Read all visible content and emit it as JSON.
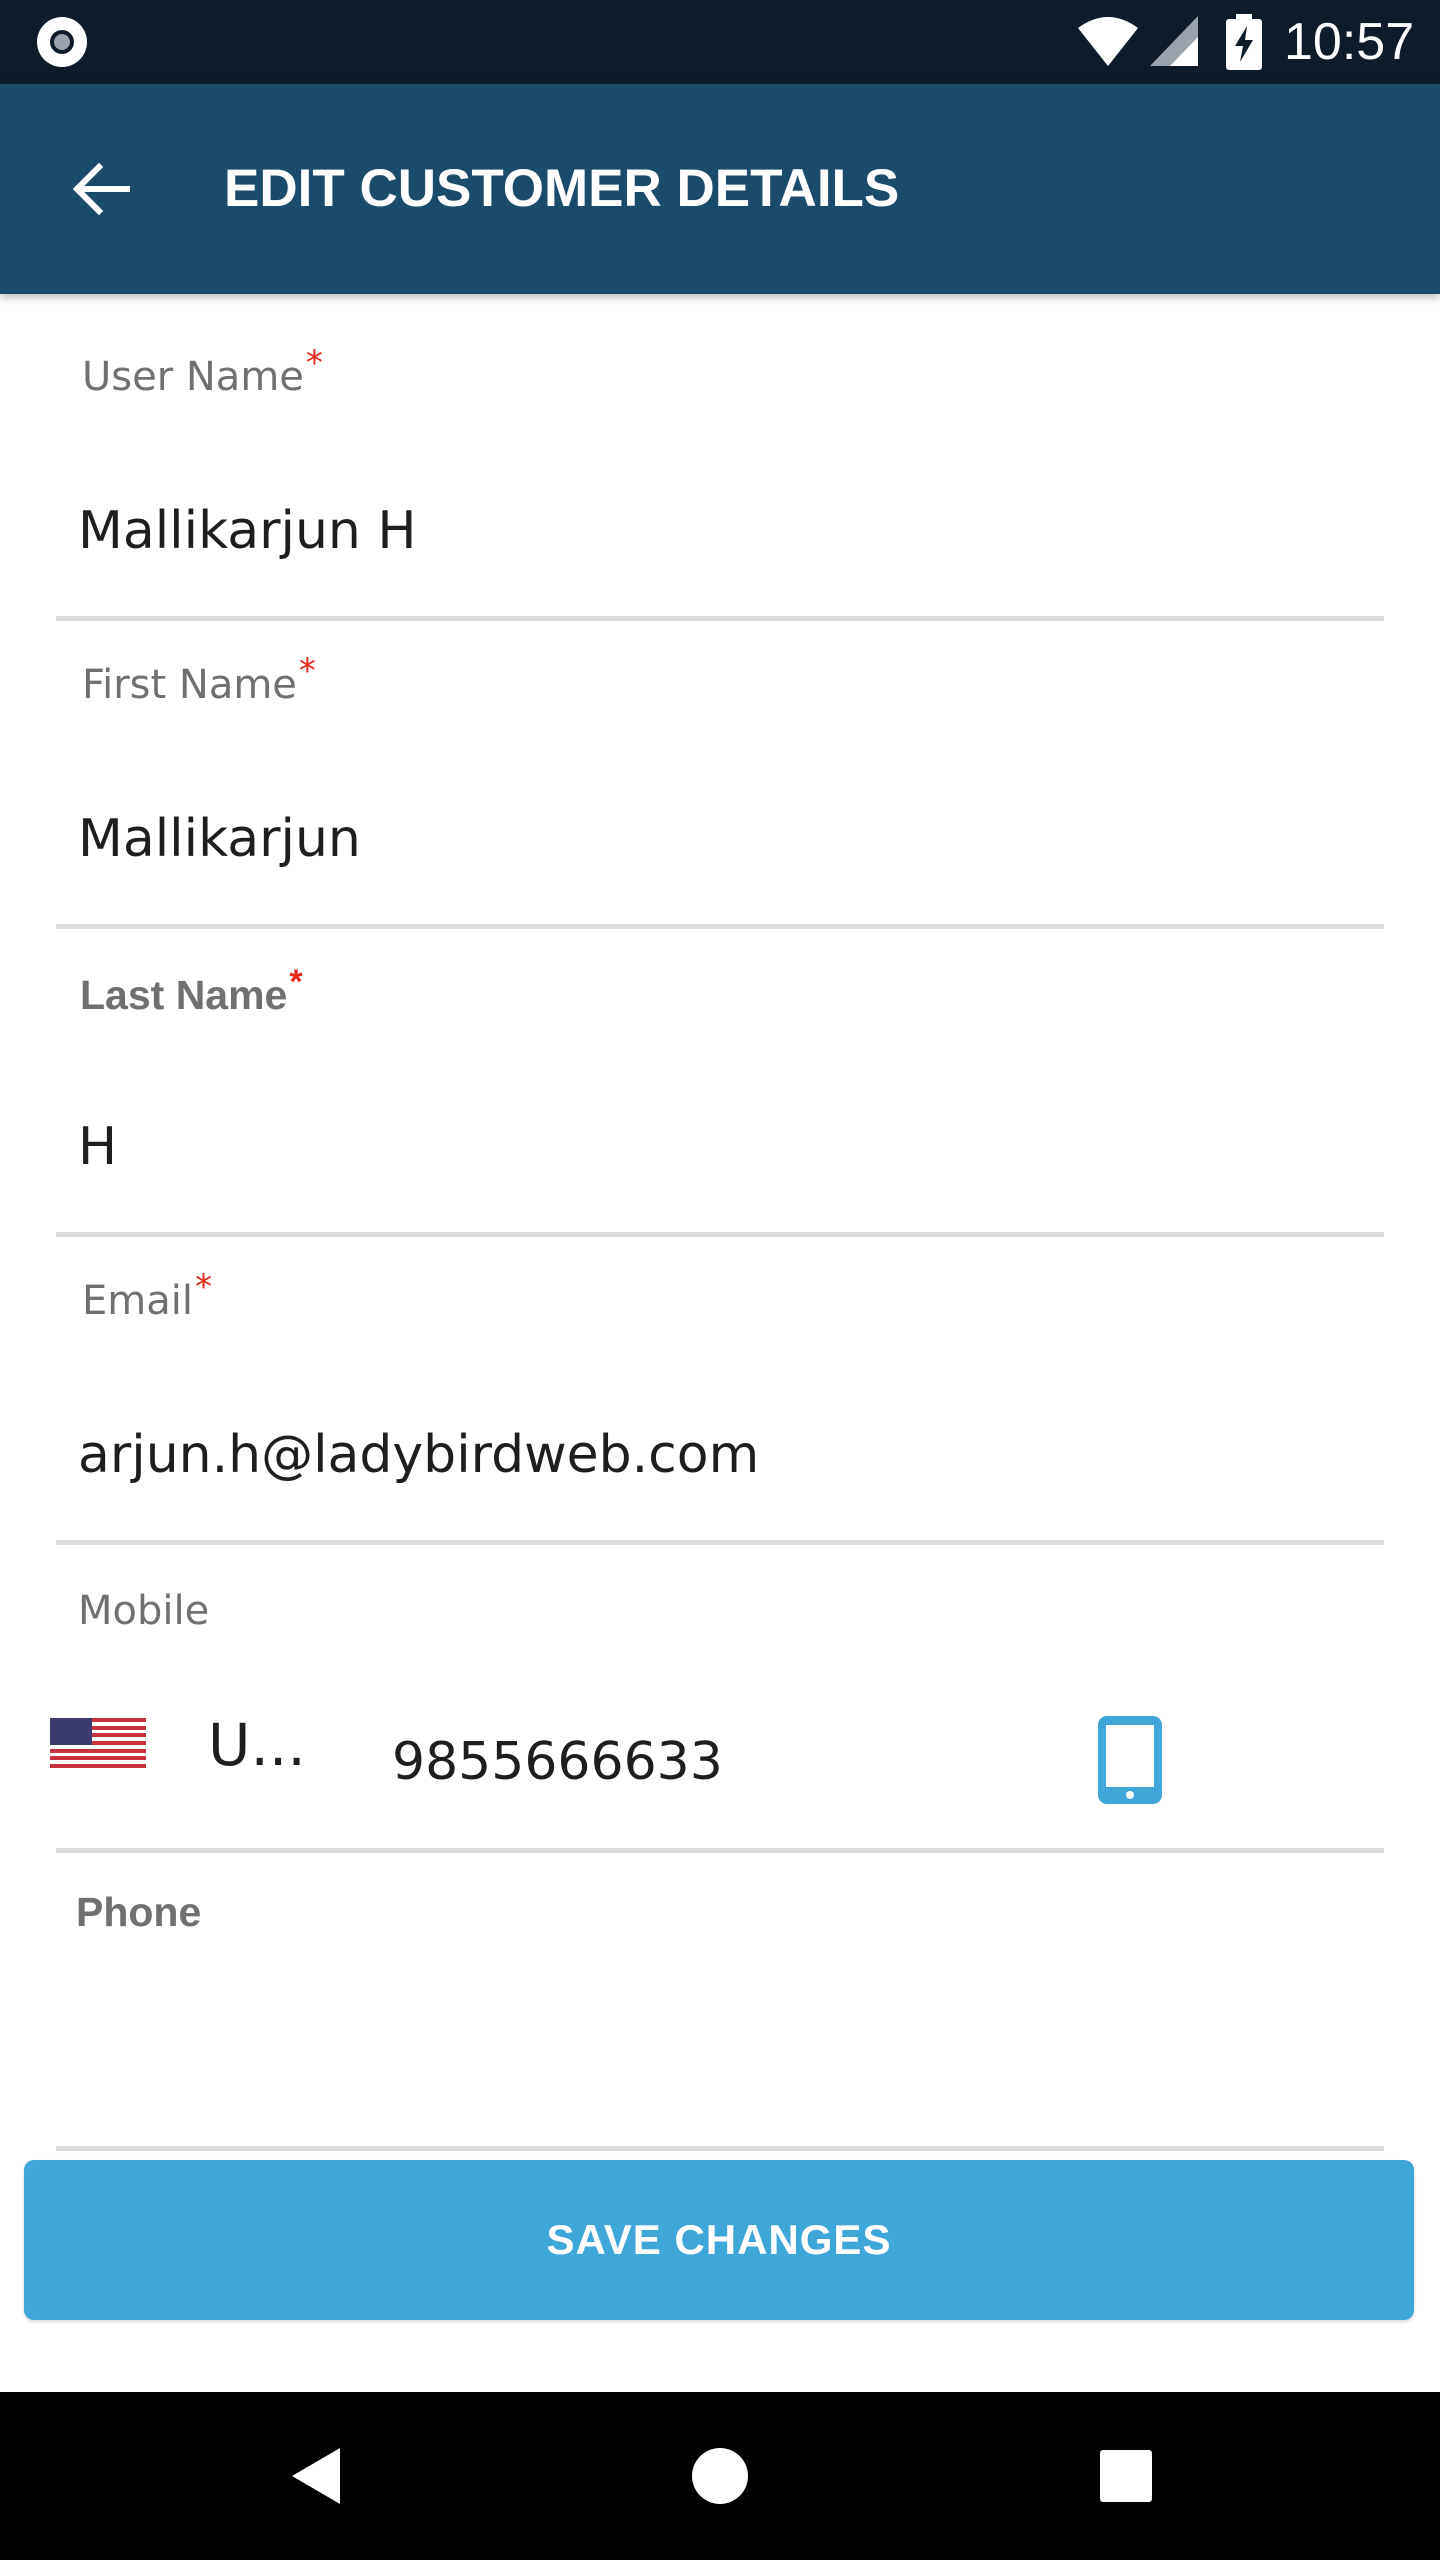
{
  "status_bar": {
    "time": "10:57",
    "icons": [
      "record-icon",
      "wifi-icon",
      "signal-icon",
      "battery-charging-icon"
    ]
  },
  "header": {
    "title": "EDIT CUSTOMER DETAILS",
    "back_icon": "arrow-left-icon"
  },
  "form": {
    "user_name": {
      "label": "User Name",
      "required_mark": "*",
      "value": "Mallikarjun H"
    },
    "first_name": {
      "label": "First Name",
      "required_mark": "*",
      "value": "Mallikarjun"
    },
    "last_name": {
      "label": "Last Name",
      "required_mark": "*",
      "value": "H"
    },
    "email": {
      "label": "Email",
      "required_mark": "*",
      "value": "arjun.h@ladybirdweb.com"
    },
    "mobile": {
      "label": "Mobile",
      "country_flag": "us-flag-icon",
      "country_code": "U...",
      "value": "9855666633",
      "device_icon": "tablet-icon"
    },
    "phone": {
      "label": "Phone",
      "value": ""
    }
  },
  "actions": {
    "save_label": "SAVE CHANGES"
  },
  "colors": {
    "status_bar": "#0d1b2a",
    "app_bar": "#1b4b6b",
    "required": "#e8261a",
    "save_button": "#3fa7d8",
    "device_icon": "#3fa7d8"
  }
}
